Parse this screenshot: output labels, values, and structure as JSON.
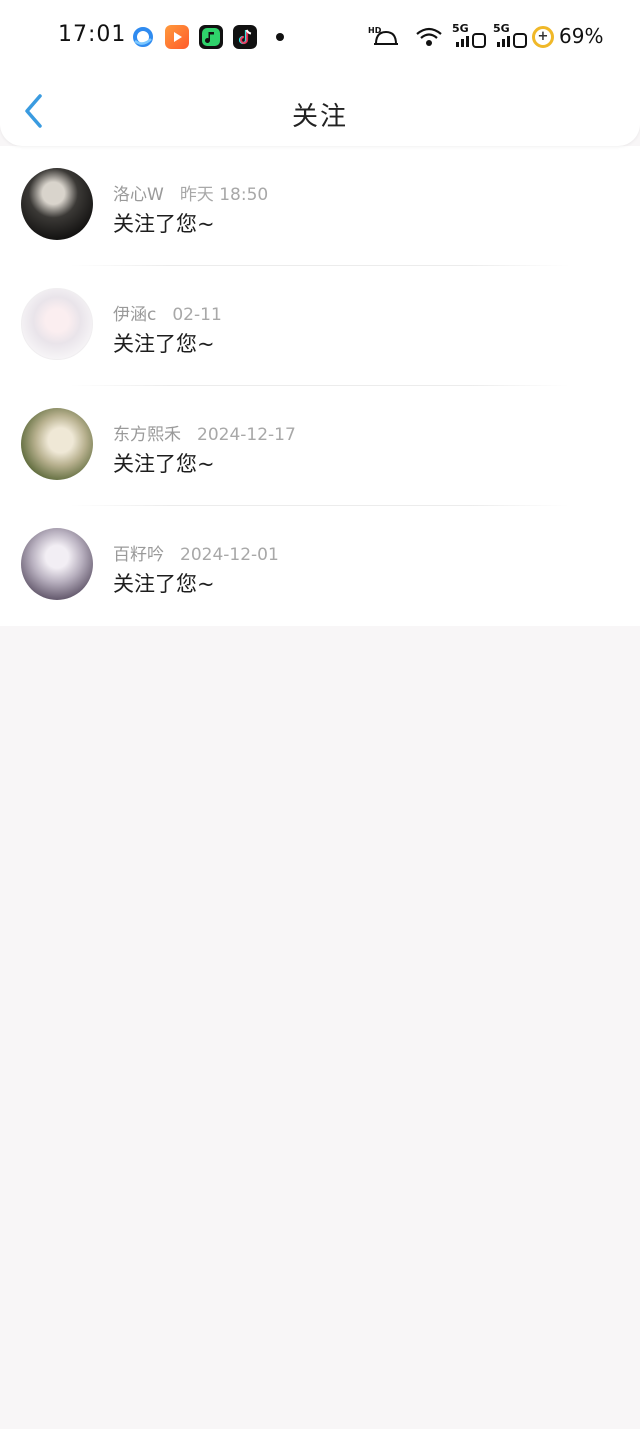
{
  "status_bar": {
    "time": "17:01",
    "battery": "69%",
    "network_1": "5G",
    "network_2": "5G",
    "hd_label": "HD",
    "icons": [
      "browser-app-icon",
      "video-app-icon",
      "music-app-icon",
      "tiktok-app-icon",
      "notification-dot",
      "hd-call-icon",
      "wifi-icon",
      "signal-5g-icon",
      "signal-5g-icon",
      "battery-saver-icon"
    ]
  },
  "header": {
    "title": "关注",
    "back_icon": "chevron-left-icon"
  },
  "colors": {
    "accent": "#3a9be0",
    "page_bg": "#f8f6f7",
    "meta_text": "#9a9a9a"
  },
  "notifications": [
    {
      "username": "洛心W",
      "time": "昨天 18:50",
      "message": "关注了您~"
    },
    {
      "username": "伊涵c",
      "time": "02-11",
      "message": "关注了您~"
    },
    {
      "username": "东方熙禾",
      "time": "2024-12-17",
      "message": "关注了您~"
    },
    {
      "username": "百籽吟",
      "time": "2024-12-01",
      "message": "关注了您~"
    }
  ]
}
